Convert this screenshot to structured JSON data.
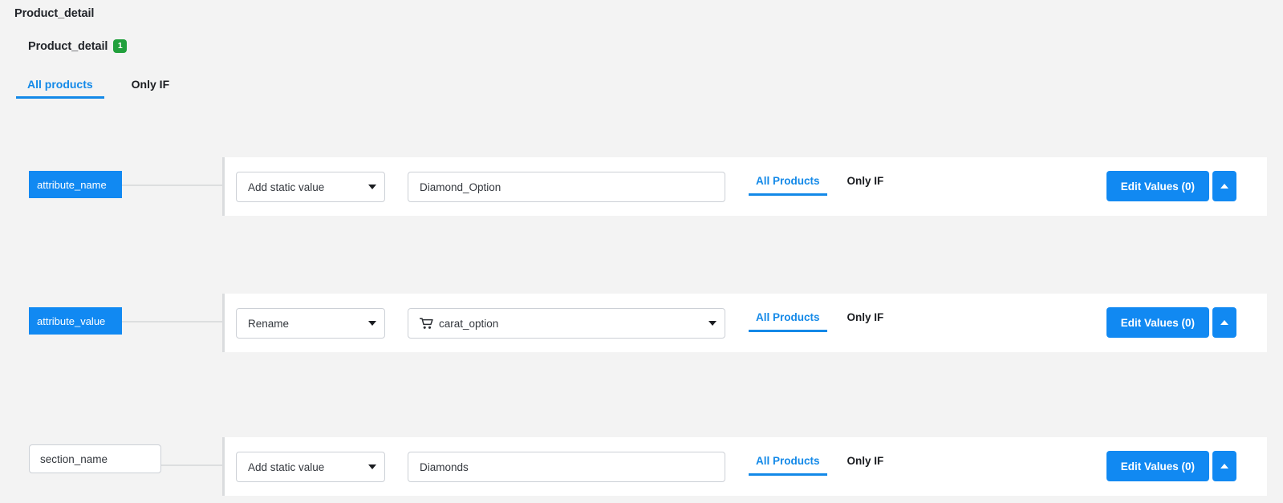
{
  "header": {
    "page_title": "Product_detail",
    "group_label": "Product_detail",
    "group_badge": "1"
  },
  "top_tabs": [
    {
      "label": "All products",
      "active": true
    },
    {
      "label": "Only IF",
      "active": false
    }
  ],
  "colors": {
    "accent_blue": "#1189f2",
    "tab_blue": "#1389e8",
    "badge_green": "#21a03c",
    "page_bg": "#f3f3f3",
    "card_bg": "#ffffff",
    "border_grey": "#ccd0d6"
  },
  "rows": [
    {
      "field_label": "attribute_name",
      "field_style": "chip",
      "action": "Add static value",
      "value": "Diamond_Option",
      "value_type": "text",
      "value_icon": "",
      "tabs": [
        {
          "label": "All Products",
          "active": true
        },
        {
          "label": "Only IF",
          "active": false
        }
      ],
      "edit_button": "Edit Values (0)",
      "toggle_icon": "caret-up-icon"
    },
    {
      "field_label": "attribute_value",
      "field_style": "chip",
      "action": "Rename",
      "value": "carat_option",
      "value_type": "select",
      "value_icon": "shopping-cart-icon",
      "tabs": [
        {
          "label": "All Products",
          "active": true
        },
        {
          "label": "Only IF",
          "active": false
        }
      ],
      "edit_button": "Edit Values (0)",
      "toggle_icon": "caret-up-icon"
    },
    {
      "field_label": "section_name",
      "field_style": "input",
      "action": "Add static value",
      "value": "Diamonds",
      "value_type": "text",
      "value_icon": "",
      "tabs": [
        {
          "label": "All Products",
          "active": true
        },
        {
          "label": "Only IF",
          "active": false
        }
      ],
      "edit_button": "Edit Values (0)",
      "toggle_icon": "caret-up-icon"
    }
  ]
}
